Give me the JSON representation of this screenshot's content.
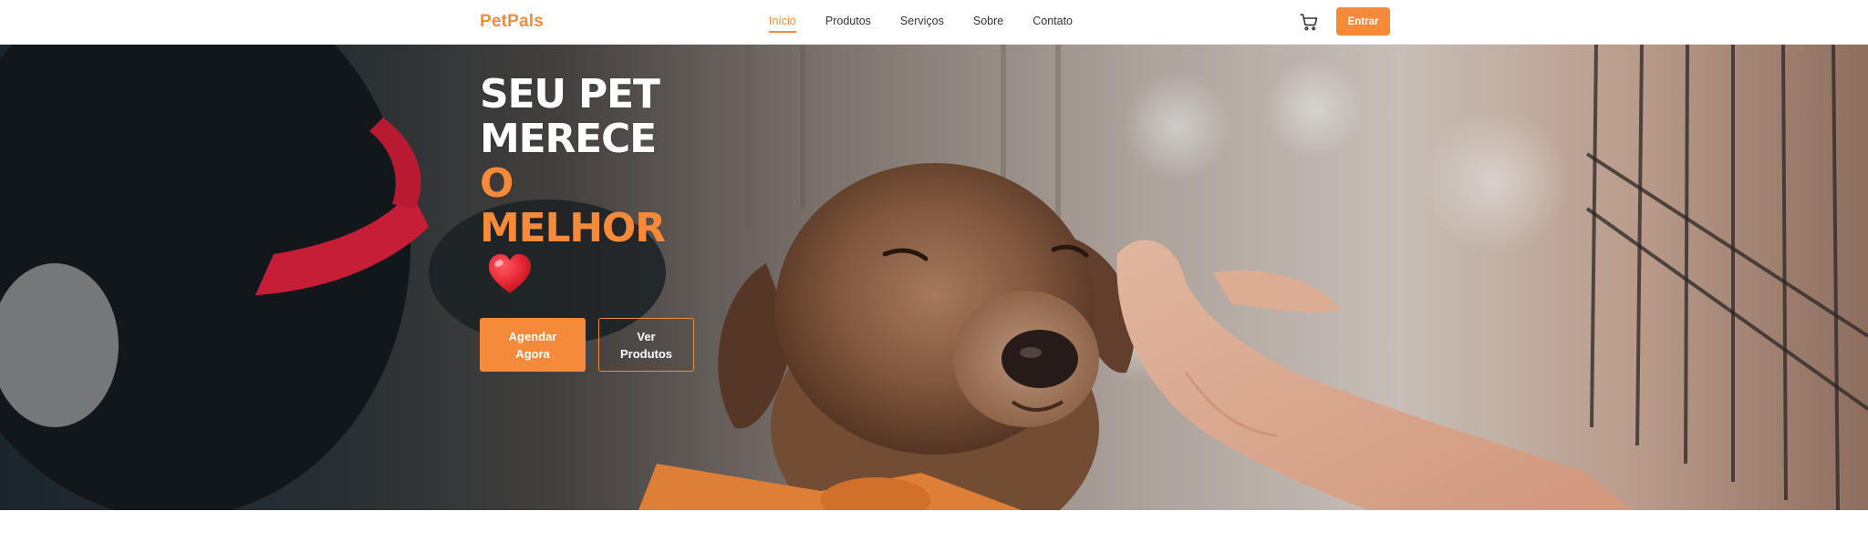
{
  "header": {
    "logo": "PetPals",
    "nav": [
      {
        "label": "Início",
        "active": true
      },
      {
        "label": "Produtos",
        "active": false
      },
      {
        "label": "Serviços",
        "active": false
      },
      {
        "label": "Sobre",
        "active": false
      },
      {
        "label": "Contato",
        "active": false
      }
    ],
    "cart_icon": "shopping-cart-icon",
    "login_label": "Entrar"
  },
  "hero": {
    "title_lines": [
      "SEU PET",
      "MERECE"
    ],
    "title_accent_lines": [
      "O",
      "MELHOR"
    ],
    "heart_icon": "heart-icon",
    "primary_button": "Agendar Agora",
    "secondary_button": "Ver Produtos"
  },
  "colors": {
    "accent": "#f58a3a",
    "heart": "#e62634",
    "text_dark": "#333333",
    "white": "#ffffff"
  }
}
